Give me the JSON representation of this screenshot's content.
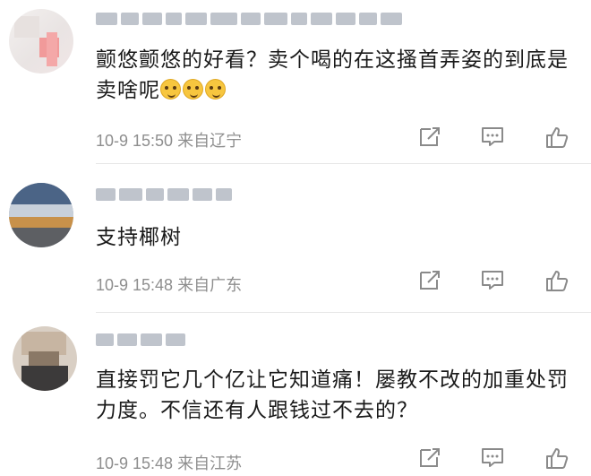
{
  "comments": [
    {
      "text": "颤悠颤悠的好看？卖个喝的在这搔首弄姿的到底是卖啥呢",
      "emoji_count": 3,
      "meta": "10-9 15:50 来自辽宁"
    },
    {
      "text": "支持椰树",
      "meta": "10-9 15:48 来自广东"
    },
    {
      "text": "直接罚它几个亿让它知道痛！屡教不改的加重处罚力度。不信还有人跟钱过不去的？",
      "meta": "10-9 15:48 来自江苏"
    }
  ],
  "icons": {
    "share": "share-icon",
    "reply": "comment-icon",
    "like": "thumbs-up-icon"
  },
  "colors": {
    "text": "#1a1a1a",
    "meta": "#8e8e8e",
    "icon": "#8a8a8a",
    "divider": "#e6e6e6",
    "emoji": "#f7c63f"
  }
}
